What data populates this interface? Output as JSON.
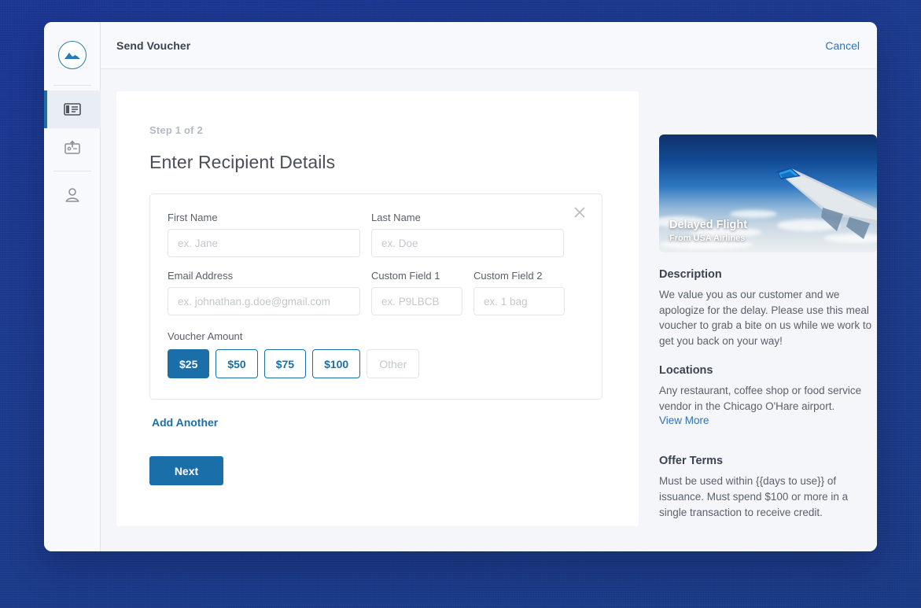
{
  "window": {
    "logo_icon": "mountain-logo-icon"
  },
  "sidebar": {
    "items": [
      {
        "icon": "voucher-ticket-icon",
        "name": "sidebar-item-vouchers",
        "active": true
      },
      {
        "icon": "send-card-icon",
        "name": "sidebar-item-send",
        "active": false
      },
      {
        "icon": "user-profile-icon",
        "name": "sidebar-item-account",
        "active": false
      }
    ]
  },
  "topbar": {
    "title": "Send Voucher",
    "cancel_label": "Cancel"
  },
  "form": {
    "step_label": "Step 1 of 2",
    "title": "Enter Recipient Details",
    "close_icon": "close-icon",
    "fields": {
      "first_name": {
        "label": "First Name",
        "placeholder": "ex. Jane",
        "value": ""
      },
      "last_name": {
        "label": "Last Name",
        "placeholder": "ex. Doe",
        "value": ""
      },
      "email": {
        "label": "Email Address",
        "placeholder": "ex. johnathan.g.doe@gmail.com",
        "value": ""
      },
      "custom_field_1": {
        "label": "Custom Field 1",
        "placeholder": "ex. P9LBCB",
        "value": ""
      },
      "custom_field_2": {
        "label": "Custom Field 2",
        "placeholder": "ex. 1 bag",
        "value": ""
      }
    },
    "amount": {
      "label": "Voucher Amount",
      "options": [
        "$25",
        "$50",
        "$75",
        "$100"
      ],
      "selected": "$25",
      "other_label": "Other"
    },
    "add_another_label": "Add Another",
    "next_label": "Next"
  },
  "offer": {
    "image_title": "Delayed Flight",
    "image_subtitle": "From USA Airlines",
    "sections": [
      {
        "heading": "Description",
        "body": "We value you as our customer and we apologize for the delay. Please use this meal voucher to grab a bite on us while we work to get you back on your way!"
      },
      {
        "heading": "Locations",
        "body": "Any restaurant, coffee shop or food service vendor in the Chicago O'Hare airport.",
        "link": "View More"
      },
      {
        "heading": "Offer Terms",
        "body": "Must be used within {{days to use}} of issuance. Must spend $100 or more in a single transaction to receive credit."
      }
    ]
  },
  "colors": {
    "accent_blue": "#1b6fa8",
    "link_blue": "#2b72b8",
    "backdrop_navy": "#1e3788",
    "panel_bg": "#f4f6fa"
  }
}
